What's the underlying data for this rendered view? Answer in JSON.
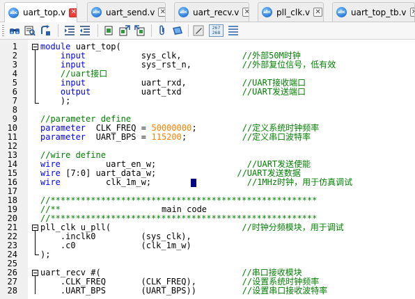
{
  "tabs": [
    {
      "label": "uart_top.v",
      "active": true,
      "icon": "abc"
    },
    {
      "label": "uart_send.v",
      "active": false,
      "icon": "abc"
    },
    {
      "label": "uart_recv.v",
      "active": false,
      "icon": "abc"
    },
    {
      "label": "pll_clk.v",
      "active": false,
      "icon": "abc"
    },
    {
      "label": "uart_top_tb.v",
      "active": false,
      "icon": "abc"
    }
  ],
  "toolbar": {
    "line_col": {
      "line": "267",
      "col": "268"
    },
    "icons": [
      "binoculars-icon",
      "find-icon",
      "goto-icon",
      "indent-icon",
      "outdent-icon",
      "bookmark-icon",
      "bookmark-next-icon",
      "bookmark-prev-icon",
      "attach-icon",
      "layers-icon",
      "edit-icon",
      "list-icon"
    ]
  },
  "accent_colors": {
    "keyword": "#0000ff",
    "comment": "#008000",
    "number": "#ff8000",
    "caret": "#000080"
  },
  "code": [
    {
      "n": "1",
      "tokens": [
        [
          "kw",
          "module"
        ],
        [
          "id",
          " uart_top("
        ]
      ]
    },
    {
      "n": "2",
      "tokens": [
        [
          "kw",
          "    input"
        ],
        [
          "id",
          "           sys_clk,"
        ],
        [
          "cm",
          "            //外部50M时钟"
        ]
      ]
    },
    {
      "n": "3",
      "tokens": [
        [
          "kw",
          "    input"
        ],
        [
          "id",
          "           sys_rst_n,"
        ],
        [
          "cm",
          "          //外部复位信号，低有效"
        ]
      ]
    },
    {
      "n": "4",
      "tokens": [
        [
          "cm",
          "    //uart接口"
        ]
      ]
    },
    {
      "n": "5",
      "tokens": [
        [
          "kw",
          "    input"
        ],
        [
          "id",
          "           uart_rxd,"
        ],
        [
          "cm",
          "           //UART接收端口"
        ]
      ]
    },
    {
      "n": "6",
      "tokens": [
        [
          "kw",
          "    output"
        ],
        [
          "id",
          "          uart_txd"
        ],
        [
          "cm",
          "            //UART发送端口"
        ]
      ]
    },
    {
      "n": "7",
      "tokens": [
        [
          "id",
          "    );"
        ]
      ]
    },
    {
      "n": "8",
      "tokens": []
    },
    {
      "n": "9",
      "tokens": [
        [
          "cm",
          "//parameter define"
        ]
      ]
    },
    {
      "n": "10",
      "tokens": [
        [
          "kw",
          "parameter"
        ],
        [
          "id",
          "  CLK_FREQ = "
        ],
        [
          "num",
          "50000000"
        ],
        [
          "id",
          ";"
        ],
        [
          "cm",
          "         //定义系统时钟频率"
        ]
      ]
    },
    {
      "n": "11",
      "tokens": [
        [
          "kw",
          "parameter"
        ],
        [
          "id",
          "  UART_BPS = "
        ],
        [
          "num",
          "115200"
        ],
        [
          "id",
          ";"
        ],
        [
          "cm",
          "           //定义串口波特率"
        ]
      ]
    },
    {
      "n": "12",
      "tokens": []
    },
    {
      "n": "13",
      "tokens": [
        [
          "cm",
          "//wire define"
        ]
      ]
    },
    {
      "n": "14",
      "tokens": [
        [
          "kw",
          "wire"
        ],
        [
          "id",
          "         uart_en_w;"
        ],
        [
          "cm",
          "                  //UART发送使能"
        ]
      ]
    },
    {
      "n": "15",
      "tokens": [
        [
          "kw",
          "wire"
        ],
        [
          "id",
          " [7:0] uart_data_w;"
        ],
        [
          "cm",
          "                //UART发送数据"
        ]
      ]
    },
    {
      "n": "16",
      "tokens": [
        [
          "kw",
          "wire"
        ],
        [
          "id",
          "         clk_1m_w;"
        ],
        [
          "cm",
          "                   //1MHz时钟，用于仿真调试"
        ]
      ]
    },
    {
      "n": "17",
      "tokens": []
    },
    {
      "n": "18",
      "tokens": [
        [
          "cm",
          "//*****************************************************"
        ]
      ]
    },
    {
      "n": "19",
      "tokens": [
        [
          "cm",
          "//**                    "
        ],
        [
          "id",
          "main code"
        ]
      ]
    },
    {
      "n": "20",
      "tokens": [
        [
          "cm",
          "//*****************************************************"
        ]
      ]
    },
    {
      "n": "21",
      "tokens": [
        [
          "id",
          "pll_clk u_pll("
        ],
        [
          "cm",
          "                          //时钟分频模块，用于调试"
        ]
      ]
    },
    {
      "n": "22",
      "tokens": [
        [
          "id",
          "    .inclk0         (sys_clk),"
        ]
      ]
    },
    {
      "n": "23",
      "tokens": [
        [
          "id",
          "    .c0             (clk_1m_w)"
        ]
      ]
    },
    {
      "n": "24",
      "tokens": [
        [
          "id",
          ");"
        ]
      ]
    },
    {
      "n": "25",
      "tokens": []
    },
    {
      "n": "26",
      "tokens": [
        [
          "id",
          "uart_recv #("
        ],
        [
          "cm",
          "                            //串口接收模块"
        ]
      ]
    },
    {
      "n": "27",
      "tokens": [
        [
          "id",
          "    .CLK_FREQ       (CLK_FREQ),"
        ],
        [
          "cm",
          "         //设置系统时钟频率"
        ]
      ]
    },
    {
      "n": "28",
      "tokens": [
        [
          "id",
          "    .UART_BPS       (UART_BPS))"
        ],
        [
          "cm",
          "         //设置串口接收波特率"
        ]
      ]
    }
  ]
}
